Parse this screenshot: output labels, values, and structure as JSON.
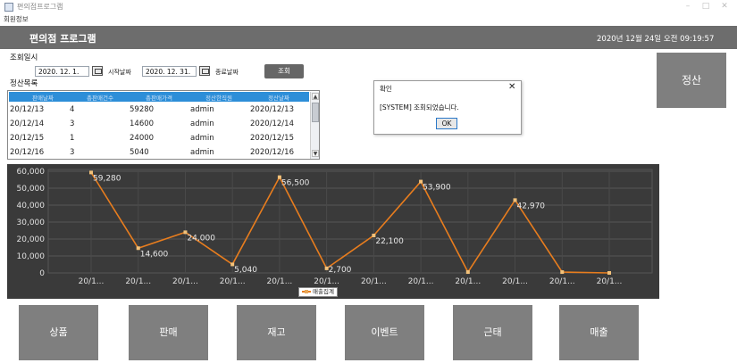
{
  "window": {
    "title": "편의점프로그램",
    "controls": [
      "–",
      "□",
      "✕"
    ]
  },
  "menubar": {
    "items": [
      "회원정보"
    ]
  },
  "header": {
    "title": "편의점 프로그램",
    "datetime": "2020년 12월 24일 오전 09:19:57"
  },
  "query": {
    "section_label": "조회일시",
    "start_date": "2020. 12. 1.",
    "start_label": "시작날짜",
    "end_date": "2020. 12. 31.",
    "end_label": "종료날짜",
    "query_button": "조회"
  },
  "settlement": {
    "section_label": "정산목록",
    "columns": [
      "판매날짜",
      "총판매건수",
      "총판매가격",
      "정산한직원",
      "정산날짜"
    ],
    "rows": [
      [
        "20/12/13",
        "4",
        "59280",
        "admin",
        "2020/12/13"
      ],
      [
        "20/12/14",
        "3",
        "14600",
        "admin",
        "2020/12/14"
      ],
      [
        "20/12/15",
        "1",
        "24000",
        "admin",
        "2020/12/15"
      ],
      [
        "20/12/16",
        "3",
        "5040",
        "admin",
        "2020/12/16"
      ]
    ]
  },
  "dialog": {
    "title": "확인",
    "message": "[SYSTEM] 조회되었습니다.",
    "ok": "OK"
  },
  "settle_button": "정산",
  "chart_data": {
    "type": "line",
    "categories": [
      "20/1...",
      "20/1...",
      "20/1...",
      "20/1...",
      "20/1...",
      "20/1...",
      "20/1...",
      "20/1...",
      "20/1...",
      "20/1...",
      "20/1...",
      "20/1..."
    ],
    "values": [
      59280,
      14600,
      24000,
      5040,
      56500,
      2700,
      22100,
      53900,
      500,
      42970,
      500,
      0
    ],
    "point_labels": [
      "59,280",
      "14,600",
      "24,000",
      "5,040",
      "56,500",
      "2,700",
      "22,100",
      "53,900",
      "",
      "42,970",
      "",
      ""
    ],
    "yticks": [
      "60,000",
      "50,000",
      "40,000",
      "30,000",
      "20,000",
      "10,000",
      "0"
    ],
    "ylim": [
      0,
      60000
    ],
    "grid": true,
    "legend": "bottom-center",
    "series_name": "매출집계",
    "line_color": "#e87d1e",
    "marker_color": "#f3c27a",
    "background": "#3a3a3a"
  },
  "nav": [
    "상품",
    "판매",
    "재고",
    "이벤트",
    "근태",
    "매출"
  ]
}
